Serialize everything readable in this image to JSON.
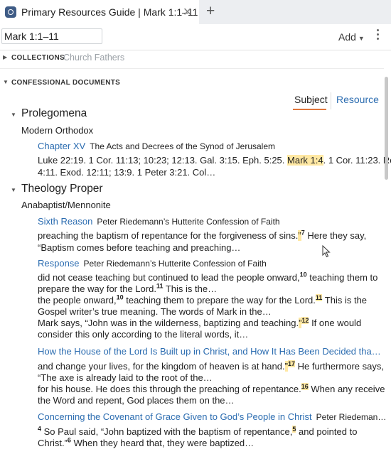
{
  "tab": {
    "title": "Primary Resources Guide | Mark 1:1–11",
    "close": "✕",
    "add": "+"
  },
  "toolbar": {
    "reference_value": "Mark 1:1–11",
    "add_label": "Add"
  },
  "collections": {
    "label": "COLLECTIONS",
    "value": "Church Fathers"
  },
  "confessional": {
    "label": "CONFESSIONAL DOCUMENTS"
  },
  "toggle": {
    "subject": "Subject",
    "resource": "Resource",
    "selected": "Subject"
  },
  "sections": {
    "prolegomena": {
      "heading": "Prolegomena",
      "group": "Modern Orthodox",
      "entry": {
        "link": "Chapter XV",
        "source": "The Acts and Decrees of the Synod of Jerusalem",
        "line1_a": "Luke 22:19. 1 Cor. 11:13; 10:23; 12:13. Gal. 3:15. Eph. 5:25. ",
        "line1_hl": "Mark 1:4",
        "line1_b": ". 1 Cor. 11:23. Rom.",
        "line2": "4:11. Exod. 12:11; 13:9. 1 Peter 3:21. Col…"
      }
    },
    "theology": {
      "heading": "Theology Proper",
      "group": "Anabaptist/Mennonite",
      "sixth": {
        "link": "Sixth Reason",
        "source": "Peter Riedemann’s Hutterite Confession of Faith",
        "l1_a": "preaching the baptism of repentance for the forgiveness of sins.",
        "l1_hl": "”",
        "l1_fn": "7",
        "l1_b": " Here they say,",
        "l2": "“Baptism comes before teaching and preaching…"
      },
      "response": {
        "link": "Response",
        "source": "Peter Riedemann’s Hutterite Confession of Faith",
        "a1_a": "did not cease teaching but continued to lead the people onward,",
        "a1_fn": "10",
        "a1_b": " teaching them to",
        "a2_a": "prepare the way for the Lord.",
        "a2_fn": "11",
        "a2_b": " This is the…",
        "b1_a": "the people onward,",
        "b1_fn": "10",
        "b1_b": " teaching them to prepare the way for the Lord.",
        "b1_fn2": "11",
        "b1_c": " This is the",
        "b2": "Gospel writer’s true meaning. The words of Mark in the…",
        "c1_a": "Mark says, “John was in the wilderness, baptizing and teaching.",
        "c1_hl": "”",
        "c1_fn": "12",
        "c1_b": " If one would",
        "c2": "consider this only according to the literal words, it…"
      },
      "house": {
        "link": "How the House of the Lord Is Built up in Christ, and How It Has Been Decided tha…",
        "a1_a": "and change your lives, for the kingdom of heaven is at hand.",
        "a1_hl": "”",
        "a1_fn": "17",
        "a1_b": " He furthermore says,",
        "a2": "“The axe is already laid to the root of the…",
        "b1_a": "for his house. He does this through the preaching of repentance.",
        "b1_fn": "16",
        "b1_b": " When any receive",
        "b2": "the Word and repent, God places them on the…"
      },
      "covenant": {
        "link": "Concerning the Covenant of Grace Given to God’s People in Christ",
        "source": "Peter Riedeman…",
        "a1_fn0": "4",
        "a1_a": " So Paul said, “John baptized with the baptism of repentance,",
        "a1_fn": "5",
        "a1_b": " and pointed to",
        "a2_a": "Christ.”",
        "a2_fn": "6",
        "a2_b": " When they heard that, they were baptized…"
      }
    }
  }
}
